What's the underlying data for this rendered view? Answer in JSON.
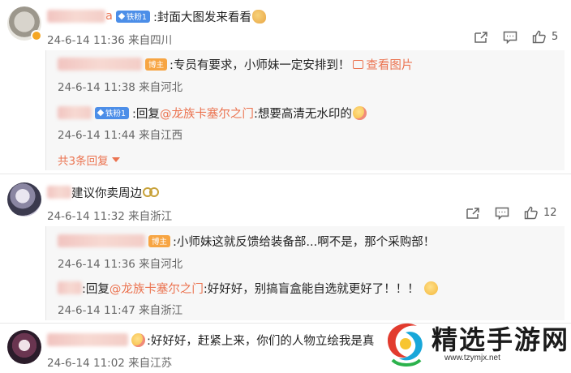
{
  "comments": [
    {
      "name_tail": "a",
      "badge": "铁粉1",
      "text": ":封面大图发来看看",
      "time": "24-6-14 11:36 来自四川",
      "like_count": "5",
      "replies": [
        {
          "badge": "博主",
          "text": ":专员有要求，小师妹一定安排到！",
          "view_image": "查看图片",
          "time": "24-6-14 11:38 来自河北"
        },
        {
          "badge": "铁粉1",
          "reply_prefix": ":回复",
          "mention": "@龙族卡塞尔之门",
          "text": ":想要高清无水印的",
          "time": "24-6-14 11:44 来自江西"
        }
      ],
      "more_replies": "共3条回复"
    },
    {
      "text": "建议你卖周边",
      "time": "24-6-14 11:32 来自浙江",
      "like_count": "12",
      "replies": [
        {
          "badge": "博主",
          "text": ":小师妹这就反馈给装备部...啊不是，那个采购部！",
          "time": "24-6-14 11:36 来自河北"
        },
        {
          "reply_prefix": ":回复",
          "mention": "@龙族卡塞尔之门",
          "text": ":好好好，别搞盲盒能自选就更好了！！！",
          "time": "24-6-14 11:47 来自浙江"
        }
      ]
    },
    {
      "text": ":好好好，赶紧上来，你们的人物立绘我是真",
      "time": "24-6-14 11:02 来自江苏"
    }
  ],
  "watermark": {
    "title": "精选手游网",
    "url": "www.tzymjx.net"
  },
  "icons": {
    "forward": "forward-icon",
    "comment": "comment-icon",
    "like": "like-icon",
    "vip": "vip-badge-icon"
  },
  "colors": {
    "accent": "#eb7350",
    "fan_badge": "#4c8ee8",
    "host_badge": "#f7a543",
    "meta": "#666666"
  }
}
